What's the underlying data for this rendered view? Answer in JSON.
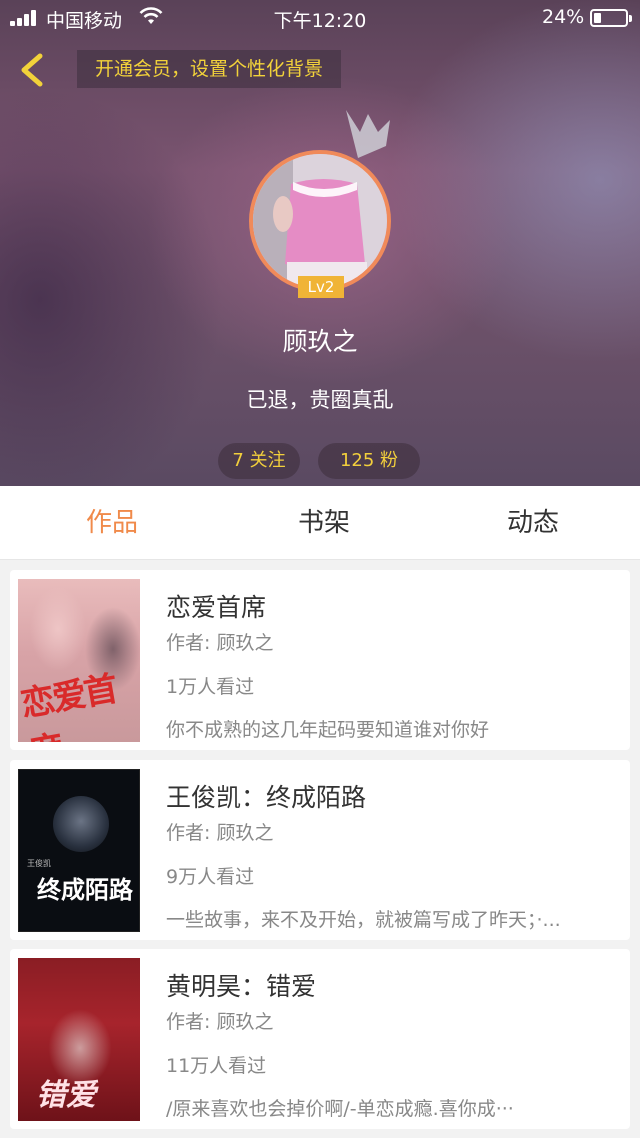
{
  "status_bar": {
    "carrier": "中国移动",
    "time": "下午12:20",
    "battery_percent": "24%",
    "battery_level": 0.24
  },
  "header": {
    "vip_banner": "开通会员，设置个性化背景",
    "level": "Lv2",
    "username": "顾玖之",
    "bio": "已退，贵圈真乱",
    "following": "7 关注",
    "fans": "125 粉丝"
  },
  "tabs": [
    {
      "label": "作品",
      "active": true
    },
    {
      "label": "书架",
      "active": false
    },
    {
      "label": "动态",
      "active": false
    }
  ],
  "books": [
    {
      "title": "恋爱首席",
      "author": "作者: 顾玖之",
      "views": "1万人看过",
      "description": "你不成熟的这几年起码要知道谁对你好",
      "cover_text": "恋爱首席"
    },
    {
      "title": "王俊凯：终成陌路",
      "author": "作者: 顾玖之",
      "views": "9万人看过",
      "description": "一些故事，来不及开始，就被篇写成了昨天；·...",
      "cover_text": "终成陌路",
      "cover_subtext": "王俊凯"
    },
    {
      "title": "黄明昊：错爱",
      "author": "作者: 顾玖之",
      "views": "11万人看过",
      "description": "/原来喜欢也会掉价啊/-单恋成瘾.喜你成···",
      "cover_text": "错爱"
    }
  ],
  "colors": {
    "accent": "#f08a4a",
    "vip_text": "#f2d23a",
    "level_badge": "#f0b436",
    "avatar_border": "#f08a5a"
  }
}
